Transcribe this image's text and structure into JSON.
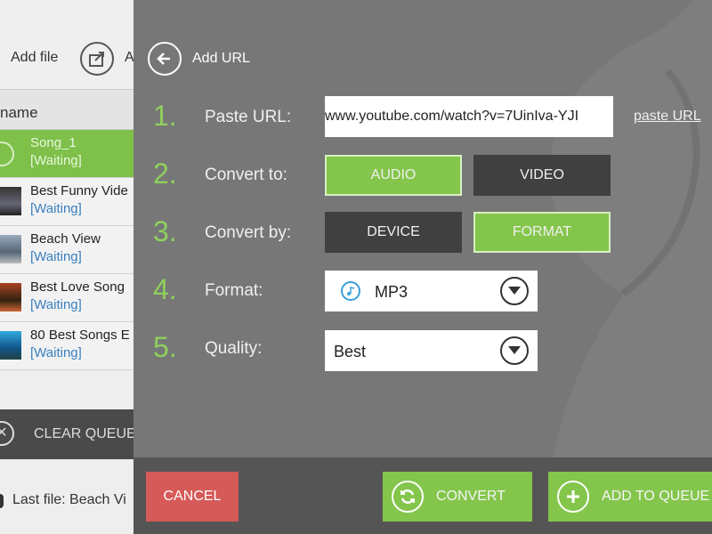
{
  "left_app": {
    "add_file_label": "Add file",
    "clipped_toolbar_label": "A",
    "list_header": "name",
    "items": [
      {
        "title": "Song_1",
        "status": "[Waiting]"
      },
      {
        "title": "Best Funny Vide",
        "status": "[Waiting]"
      },
      {
        "title": "Beach View",
        "status": "[Waiting]"
      },
      {
        "title": "Best Love Song",
        "status": "[Waiting]"
      },
      {
        "title": "80 Best Songs E",
        "status": "[Waiting]"
      }
    ],
    "clear_queue_label": "CLEAR QUEUE",
    "last_file": "Last file: Beach Vi"
  },
  "dialog": {
    "title": "Add URL",
    "steps": [
      {
        "num": "1.",
        "label": "Paste URL:"
      },
      {
        "num": "2.",
        "label": "Convert to:"
      },
      {
        "num": "3.",
        "label": "Convert by:"
      },
      {
        "num": "4.",
        "label": "Format:"
      },
      {
        "num": "5.",
        "label": "Quality:"
      }
    ],
    "url_value": "www.youtube.com/watch?v=7UinIva-YJI",
    "paste_url_link": "paste URL",
    "convert_to": {
      "audio": "AUDIO",
      "video": "VIDEO",
      "selected": "AUDIO"
    },
    "convert_by": {
      "device": "DEVICE",
      "format": "FORMAT",
      "selected": "FORMAT"
    },
    "format_value": "MP3",
    "quality_value": "Best",
    "cancel_label": "CANCEL",
    "convert_label": "CONVERT",
    "add_to_queue_label": "ADD TO QUEUE"
  },
  "colors": {
    "accent_green": "#84c64c",
    "step_number_green": "#8fd05c",
    "cancel_red": "#d55a58",
    "dialog_bg": "#777777",
    "inactive_button": "#404040"
  }
}
